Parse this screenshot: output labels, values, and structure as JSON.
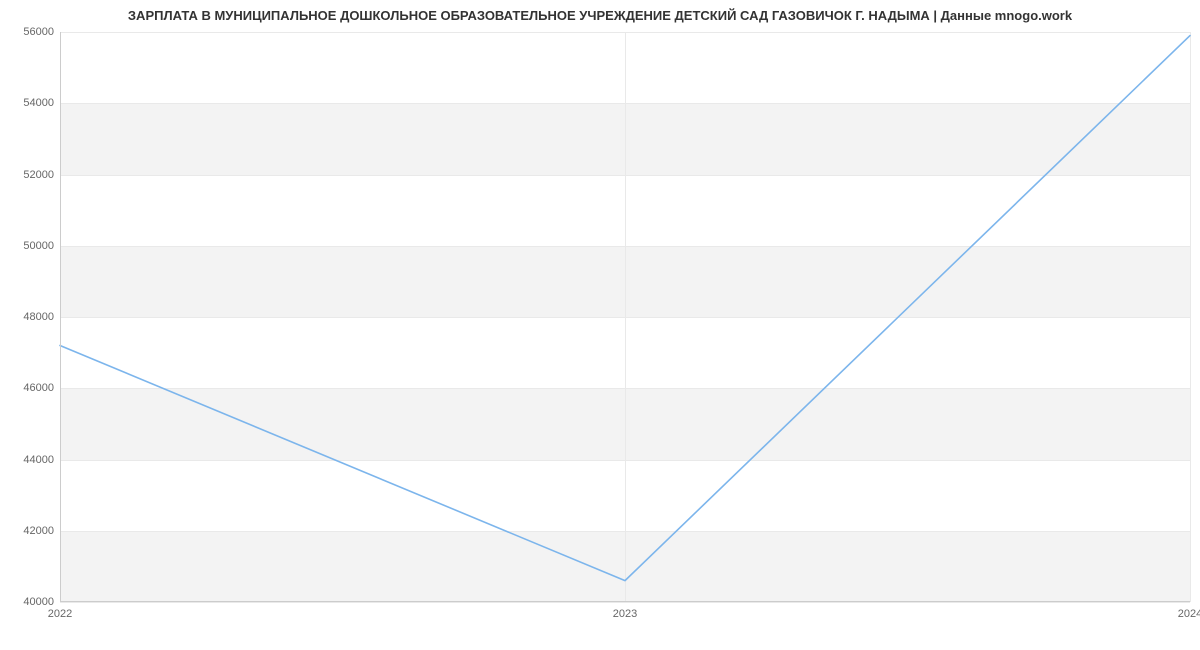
{
  "chart_data": {
    "type": "line",
    "title": "ЗАРПЛАТА В МУНИЦИПАЛЬНОЕ ДОШКОЛЬНОЕ ОБРАЗОВАТЕЛЬНОЕ УЧРЕЖДЕНИЕ ДЕТСКИЙ САД ГАЗОВИЧОК Г. НАДЫМА | Данные mnogo.work",
    "xlabel": "",
    "ylabel": "",
    "x": [
      2022,
      2023,
      2024
    ],
    "values": [
      47200,
      40600,
      55900
    ],
    "xlim": [
      2022,
      2024
    ],
    "ylim": [
      40000,
      56000
    ],
    "yticks": [
      40000,
      42000,
      44000,
      46000,
      48000,
      50000,
      52000,
      54000,
      56000
    ],
    "xticks": [
      2022,
      2023,
      2024
    ],
    "series_color": "#7cb5ec",
    "alt_band_color": "#f3f3f3",
    "grid": true
  }
}
